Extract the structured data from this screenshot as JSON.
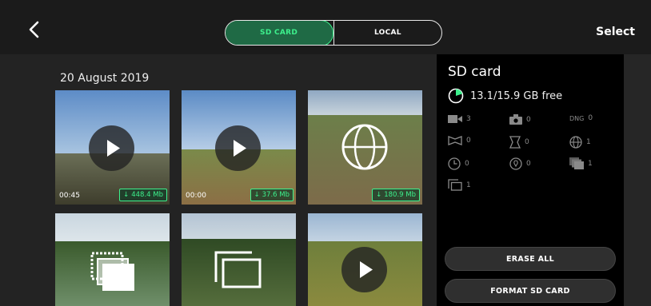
{
  "header": {
    "tabs": [
      {
        "label": "SD CARD",
        "active": true
      },
      {
        "label": "LOCAL",
        "active": false
      }
    ],
    "select_label": "Select",
    "accent_color": "#3df08c"
  },
  "gallery": {
    "date_label": "20 August 2019",
    "items": [
      {
        "type": "video",
        "duration": "00:45",
        "size": "448.4 Mb"
      },
      {
        "type": "video",
        "duration": "00:00",
        "size": "37.6 Mb"
      },
      {
        "type": "panorama-sphere",
        "duration": "",
        "size": "180.9 Mb"
      },
      {
        "type": "burst",
        "duration": "",
        "size": ""
      },
      {
        "type": "gallery-stack",
        "duration": "",
        "size": ""
      },
      {
        "type": "video",
        "duration": "",
        "size": ""
      }
    ]
  },
  "panel": {
    "title": "SD card",
    "storage": "13.1/15.9 GB free",
    "used_fraction": 0.18,
    "stats": [
      {
        "icon": "video-icon",
        "count": "3"
      },
      {
        "icon": "camera-icon",
        "count": "0"
      },
      {
        "icon": "dng-icon",
        "label": "DNG",
        "count": "0"
      },
      {
        "icon": "panorama-horizontal-icon",
        "count": "0"
      },
      {
        "icon": "panorama-vertical-icon",
        "count": "0"
      },
      {
        "icon": "panorama-sphere-icon",
        "count": "1"
      },
      {
        "icon": "timelapse-icon",
        "count": "0"
      },
      {
        "icon": "gps-lapse-icon",
        "count": "0"
      },
      {
        "icon": "burst-icon",
        "count": "1"
      },
      {
        "icon": "bracketing-icon",
        "count": "1"
      }
    ],
    "erase_label": "ERASE ALL",
    "format_label": "FORMAT SD CARD"
  }
}
